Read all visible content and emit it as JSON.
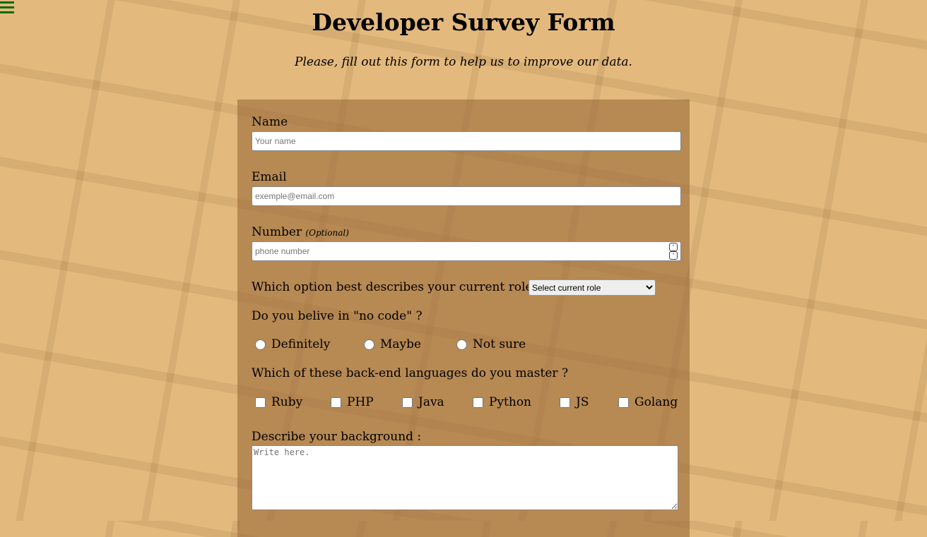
{
  "title": "Developer Survey Form",
  "description": "Please, fill out this form to help us to improve our data.",
  "name": {
    "label": "Name",
    "placeholder": "Your name"
  },
  "email": {
    "label": "Email",
    "placeholder": "exemple@email.com"
  },
  "number": {
    "label": "Number",
    "optional": "(Optional)",
    "placeholder": "phone number"
  },
  "role": {
    "label": "Which option best describes your current role ?",
    "selected": "Select current role"
  },
  "nocode": {
    "label": "Do you belive in \"no code\" ?",
    "options": [
      "Definitely",
      "Maybe",
      "Not sure"
    ]
  },
  "languages": {
    "label": "Which of these back-end languages do you master ?",
    "options": [
      "Ruby",
      "PHP",
      "Java",
      "Python",
      "JS",
      "Golang"
    ]
  },
  "background": {
    "label": "Describe your background :",
    "placeholder": "Write here."
  },
  "colors": {
    "menu": "#0b6b0b",
    "background": "#e3b97e",
    "form": "#b5835a"
  }
}
